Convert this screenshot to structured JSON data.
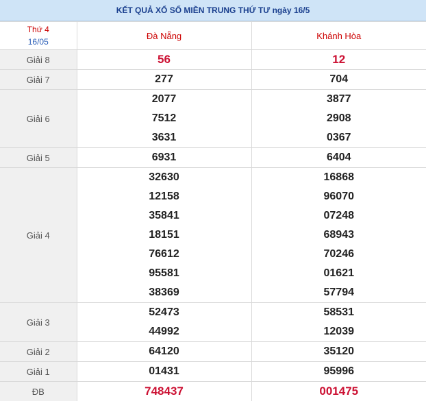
{
  "title": "KẾT QUẢ XỔ SỐ MIỀN TRUNG THỨ TƯ ngày 16/5",
  "header": {
    "day": "Thứ 4",
    "date": "16/05",
    "provinces": [
      "Đà Nẵng",
      "Khánh Hòa"
    ]
  },
  "prizes": {
    "g8": {
      "label": "Giải 8",
      "dn": [
        "56"
      ],
      "kh": [
        "12"
      ]
    },
    "g7": {
      "label": "Giải 7",
      "dn": [
        "277"
      ],
      "kh": [
        "704"
      ]
    },
    "g6": {
      "label": "Giải 6",
      "dn": [
        "2077",
        "7512",
        "3631"
      ],
      "kh": [
        "3877",
        "2908",
        "0367"
      ]
    },
    "g5": {
      "label": "Giải 5",
      "dn": [
        "6931"
      ],
      "kh": [
        "6404"
      ]
    },
    "g4": {
      "label": "Giải 4",
      "dn": [
        "32630",
        "12158",
        "35841",
        "18151",
        "76612",
        "95581",
        "38369"
      ],
      "kh": [
        "16868",
        "96070",
        "07248",
        "68943",
        "70246",
        "01621",
        "57794"
      ]
    },
    "g3": {
      "label": "Giải 3",
      "dn": [
        "52473",
        "44992"
      ],
      "kh": [
        "58531",
        "12039"
      ]
    },
    "g2": {
      "label": "Giải 2",
      "dn": [
        "64120"
      ],
      "kh": [
        "35120"
      ]
    },
    "g1": {
      "label": "Giải 1",
      "dn": [
        "01431"
      ],
      "kh": [
        "95996"
      ]
    },
    "db": {
      "label": "ĐB",
      "dn": [
        "748437"
      ],
      "kh": [
        "001475"
      ]
    }
  },
  "colors": {
    "header_bg": "#cfe4f7",
    "red": "#cc1133",
    "blue": "#2b5fb8",
    "label_bg": "#f0f0f0"
  }
}
